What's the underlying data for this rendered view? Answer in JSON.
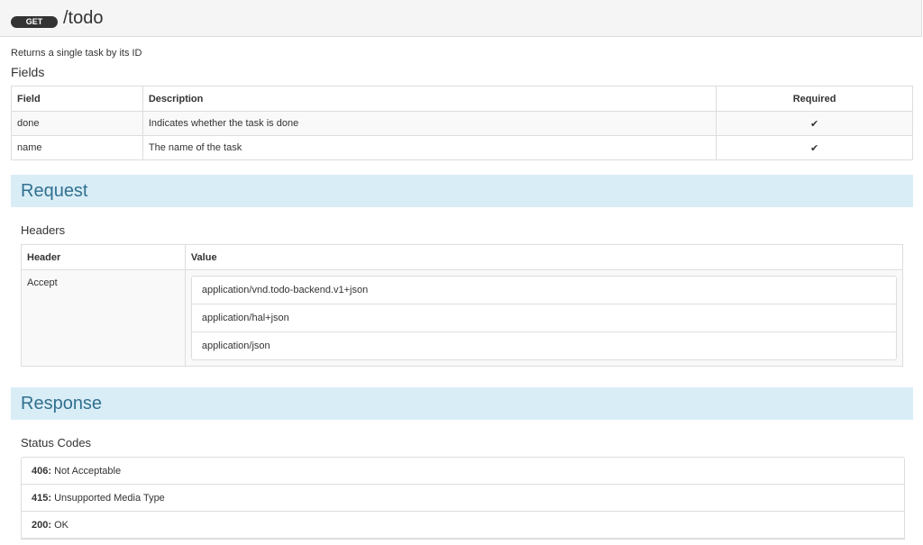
{
  "endpoint": {
    "method": "GET",
    "path": "/todo",
    "description": "Returns a single task by its ID"
  },
  "fields": {
    "title": "Fields",
    "columns": [
      "Field",
      "Description",
      "Required"
    ],
    "rows": [
      {
        "field": "done",
        "description": "Indicates whether the task is done",
        "required": "✔"
      },
      {
        "field": "name",
        "description": "The name of the task",
        "required": "✔"
      }
    ]
  },
  "request": {
    "title": "Request",
    "headers_title": "Headers",
    "columns": [
      "Header",
      "Value"
    ],
    "rows": [
      {
        "header": "Accept",
        "values": [
          "application/vnd.todo-backend.v1+json",
          "application/hal+json",
          "application/json"
        ]
      }
    ]
  },
  "response": {
    "title": "Response",
    "status_title": "Status Codes",
    "codes": [
      {
        "code": "406:",
        "text": "Not Acceptable"
      },
      {
        "code": "415:",
        "text": "Unsupported Media Type"
      },
      {
        "code": "200:",
        "text": "OK"
      }
    ]
  },
  "colors": {
    "method_badge": "#333333",
    "section_bg": "#d9edf7",
    "section_text": "#31708f"
  }
}
